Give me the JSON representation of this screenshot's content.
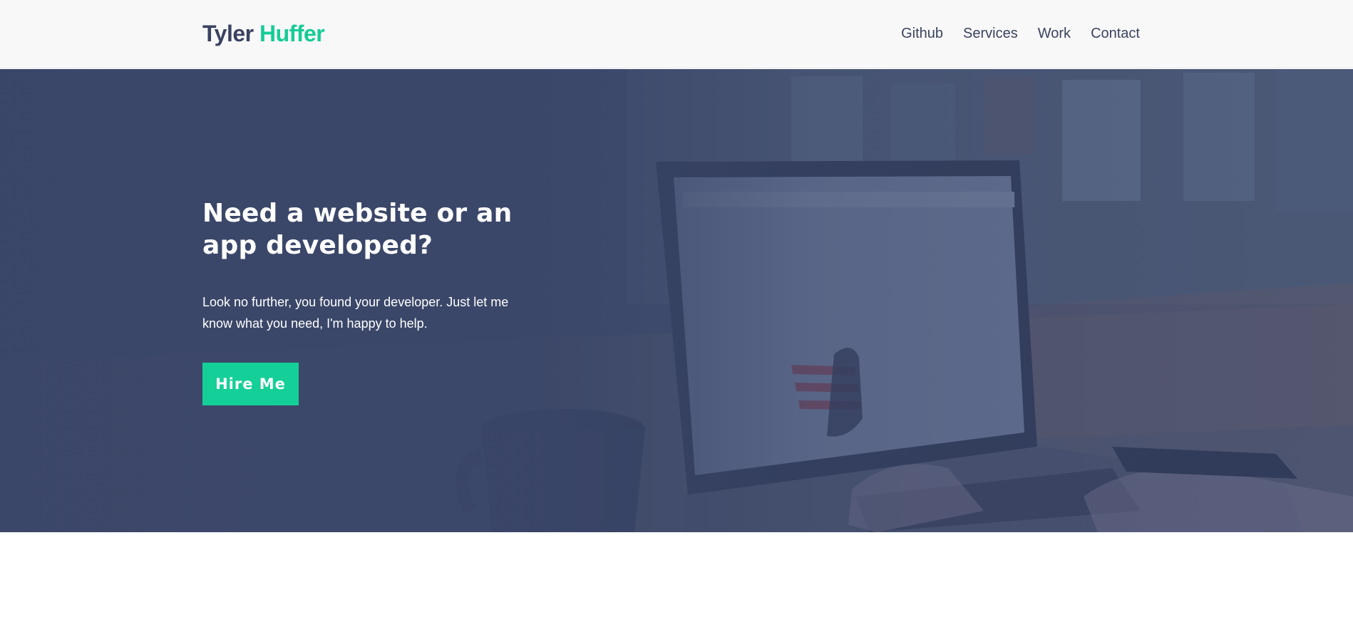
{
  "header": {
    "logo_first": "Tyler",
    "logo_last": "Huffer",
    "nav": [
      {
        "label": "Github"
      },
      {
        "label": "Services"
      },
      {
        "label": "Work"
      },
      {
        "label": "Contact"
      }
    ]
  },
  "hero": {
    "title": "Need a website or an app developed?",
    "subtitle": "Look no further, you found your developer. Just let me know what you need, I'm happy to help.",
    "cta_label": "Hire Me"
  },
  "colors": {
    "brand_dark": "#3a4262",
    "brand_accent": "#15cc96",
    "hero_overlay": "#3a4668",
    "header_bg": "#f8f8f8"
  }
}
